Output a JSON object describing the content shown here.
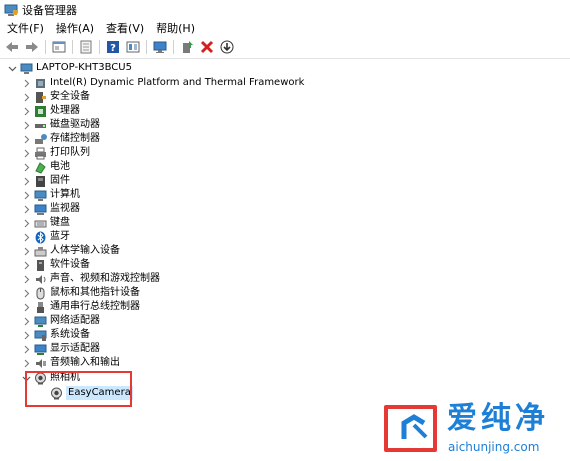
{
  "window": {
    "title": "设备管理器",
    "app_icon": "device-manager-icon"
  },
  "menu": [
    "文件(F)",
    "操作(A)",
    "查看(V)",
    "帮助(H)"
  ],
  "toolbar": [
    "back-arrow-icon",
    "forward-arrow-icon",
    "properties-icon",
    "show-hidden-icon",
    "help-icon",
    "action-icon",
    "monitor-icon",
    "add-driver-icon",
    "uninstall-icon",
    "update-driver-icon"
  ],
  "tree": {
    "root": "LAPTOP-KHT3BCU5",
    "categories": [
      {
        "label": "Intel(R) Dynamic Platform and Thermal Framework",
        "icon": "chip-icon"
      },
      {
        "label": "安全设备",
        "icon": "security-icon"
      },
      {
        "label": "处理器",
        "icon": "processor-icon"
      },
      {
        "label": "磁盘驱动器",
        "icon": "disk-icon"
      },
      {
        "label": "存储控制器",
        "icon": "storage-icon"
      },
      {
        "label": "打印队列",
        "icon": "printer-icon"
      },
      {
        "label": "电池",
        "icon": "battery-icon"
      },
      {
        "label": "固件",
        "icon": "firmware-icon"
      },
      {
        "label": "计算机",
        "icon": "computer-icon"
      },
      {
        "label": "监视器",
        "icon": "monitor-icon"
      },
      {
        "label": "键盘",
        "icon": "keyboard-icon"
      },
      {
        "label": "蓝牙",
        "icon": "bluetooth-icon"
      },
      {
        "label": "人体学输入设备",
        "icon": "hid-icon"
      },
      {
        "label": "软件设备",
        "icon": "software-device-icon"
      },
      {
        "label": "声音、视频和游戏控制器",
        "icon": "sound-icon"
      },
      {
        "label": "鼠标和其他指针设备",
        "icon": "mouse-icon"
      },
      {
        "label": "通用串行总线控制器",
        "icon": "usb-icon"
      },
      {
        "label": "网络适配器",
        "icon": "network-icon"
      },
      {
        "label": "系统设备",
        "icon": "system-device-icon"
      },
      {
        "label": "显示适配器",
        "icon": "display-adapter-icon"
      },
      {
        "label": "音频输入和输出",
        "icon": "audio-io-icon"
      }
    ],
    "expanded": {
      "label": "照相机",
      "icon": "camera-icon",
      "child": "EasyCamera"
    }
  },
  "watermark": {
    "title": "爱纯净",
    "url": "aichunjing.com"
  },
  "colors": {
    "highlight": "#e53935",
    "watermark": "#1e7fd6",
    "selection": "#cce8ff"
  }
}
